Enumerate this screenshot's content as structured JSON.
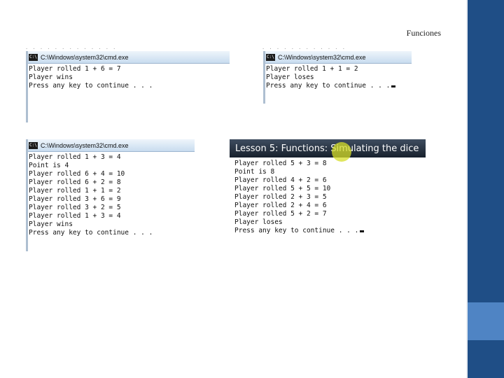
{
  "slide": {
    "title": "Funciones"
  },
  "colors": {
    "sidebar": "#1f4e86",
    "sidebar_accent": "#4f84c4",
    "banner": "#1b2533",
    "highlight": "#d6de28"
  },
  "windows": [
    {
      "title": "C:\\Windows\\system32\\cmd.exe",
      "lines": [
        "Player rolled 1 + 6 = 7",
        "Player wins",
        "Press any key to continue . . ."
      ],
      "cursor": false
    },
    {
      "title": "C:\\Windows\\system32\\cmd.exe",
      "lines": [
        "Player rolled 1 + 1 = 2",
        "Player loses",
        "Press any key to continue . . ."
      ],
      "cursor": true
    },
    {
      "title": "C:\\Windows\\system32\\cmd.exe",
      "lines": [
        "Player rolled 1 + 3 = 4",
        "Point is 4",
        "Player rolled 6 + 4 = 10",
        "Player rolled 6 + 2 = 8",
        "Player rolled 1 + 1 = 2",
        "Player rolled 3 + 6 = 9",
        "Player rolled 3 + 2 = 5",
        "Player rolled 1 + 3 = 4",
        "Player wins",
        "Press any key to continue . . ."
      ],
      "cursor": false
    },
    {
      "title": "Lesson 5: Functions: Simulating the dice",
      "lines": [
        "Player rolled 5 + 3 = 8",
        "Point is 8",
        "Player rolled 4 + 2 = 6",
        "Player rolled 5 + 5 = 10",
        "Player rolled 2 + 3 = 5",
        "Player rolled 2 + 4 = 6",
        "Player rolled 5 + 2 = 7",
        "Player loses",
        "Press any key to continue . . ."
      ],
      "cursor": true
    }
  ]
}
